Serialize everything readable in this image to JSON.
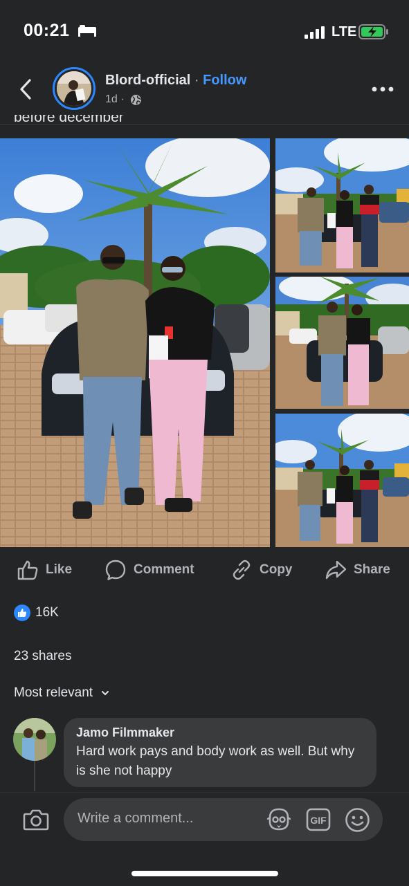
{
  "status_bar": {
    "time": "00:21",
    "network": "LTE",
    "battery_charging": true
  },
  "header": {
    "poster_name": "Blord-official",
    "separator": " · ",
    "follow_label": "Follow",
    "post_age": "1d ·",
    "icons": [
      "back-icon",
      "globe-icon",
      "more-icon"
    ]
  },
  "post": {
    "truncated_caption": "before december",
    "photos": [
      "main-photo",
      "thumb-photo-1",
      "thumb-photo-2",
      "thumb-photo-3"
    ]
  },
  "actions": {
    "like": "Like",
    "comment": "Comment",
    "copy": "Copy",
    "share": "Share"
  },
  "stats": {
    "reaction_count": "16K",
    "shares": "23 shares",
    "sort_label": "Most relevant"
  },
  "comment": {
    "author": "Jamo Filmmaker",
    "text": "Hard work pays and body work as well.  But why is she not happy"
  },
  "composer": {
    "placeholder": "Write a comment...",
    "gif_label": "GIF"
  },
  "colors": {
    "background": "#242526",
    "accent": "#2d88ff",
    "bubble": "#3a3b3c",
    "secondary_text": "#b0b3b8"
  }
}
